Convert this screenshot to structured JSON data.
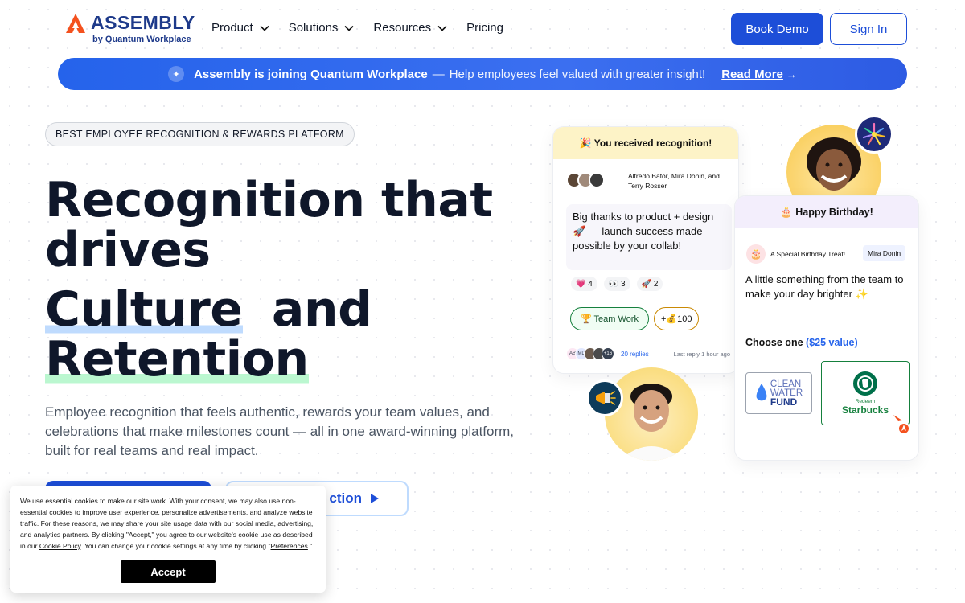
{
  "nav": {
    "logo_text": "ASSEMBLY",
    "logo_sub": "by Quantum Workplace",
    "items": [
      {
        "label": "Product",
        "dropdown": true
      },
      {
        "label": "Solutions",
        "dropdown": true
      },
      {
        "label": "Resources",
        "dropdown": true
      },
      {
        "label": "Pricing",
        "dropdown": false
      }
    ],
    "book_demo": "Book Demo",
    "sign_in": "Sign In"
  },
  "banner": {
    "bold": "Assembly is joining Quantum Workplace",
    "dash": "—",
    "text": "Help employees feel valued with greater insight!",
    "link": "Read More",
    "arrow": "→"
  },
  "hero": {
    "eyebrow": "BEST EMPLOYEE RECOGNITION & REWARDS PLATFORM",
    "title_line1": "Recognition that",
    "title_line2": "drives",
    "title_word_culture": "Culture",
    "title_word_and": "and",
    "title_word_retention": "Retention",
    "subtitle": "Employee recognition that feels authentic, rewards your team values, and celebrations that make milestones count — all in one award-winning platform, built for real teams and real impact.",
    "cta_secondary": "ction"
  },
  "cookie": {
    "text_before": "We use essential cookies to make our site work. With your consent, we may also use non-essential cookies to improve user experience, personalize advertisements, and analyze website traffic. For these reasons, we may share your site usage data with our social media, advertising, and analytics partners. By clicking \"Accept,\" you agree to our website's cookie use as described in our ",
    "policy_link": "Cookie Policy",
    "text_middle": ". You can change your cookie settings at any time by clicking \"",
    "prefs_link": "Preferences",
    "text_after": ".\"",
    "accept": "Accept"
  },
  "recognition_card": {
    "header": "🎉 You received recognition!",
    "names": "Alfredo Bator, Mira Donin, and Terry Rosser",
    "message": "Big thanks to product + design 🚀 — launch success made possible by your collab!",
    "reactions": [
      {
        "emoji": "💗",
        "count": "4"
      },
      {
        "emoji": "👀",
        "count": "3"
      },
      {
        "emoji": "🚀",
        "count": "2"
      }
    ],
    "tag": "🏆 Team Work",
    "points": "+💰100",
    "footer_avatars": [
      "AB",
      "MD",
      "",
      "",
      "+16"
    ],
    "replies": "20 replies",
    "last_reply": "Last reply 1 hour ago"
  },
  "birthday_card": {
    "header": "🎂 Happy Birthday!",
    "treat": "A Special Birthday Treat!",
    "from": "Mira Donin",
    "message": "A little something from the team to make your day brighter ✨",
    "choose": "Choose one",
    "value": "($25 value)",
    "option1_lines": [
      "CLEAN",
      "WATER",
      "FUND"
    ],
    "option2_redeem": "Redeem",
    "option2_name": "Starbucks"
  },
  "colors": {
    "primary": "#1d4ed8",
    "banner": "#2563eb",
    "heading": "#0f172a",
    "recognition_header": "#fdf3c7",
    "birthday_header": "#f3eefc"
  }
}
